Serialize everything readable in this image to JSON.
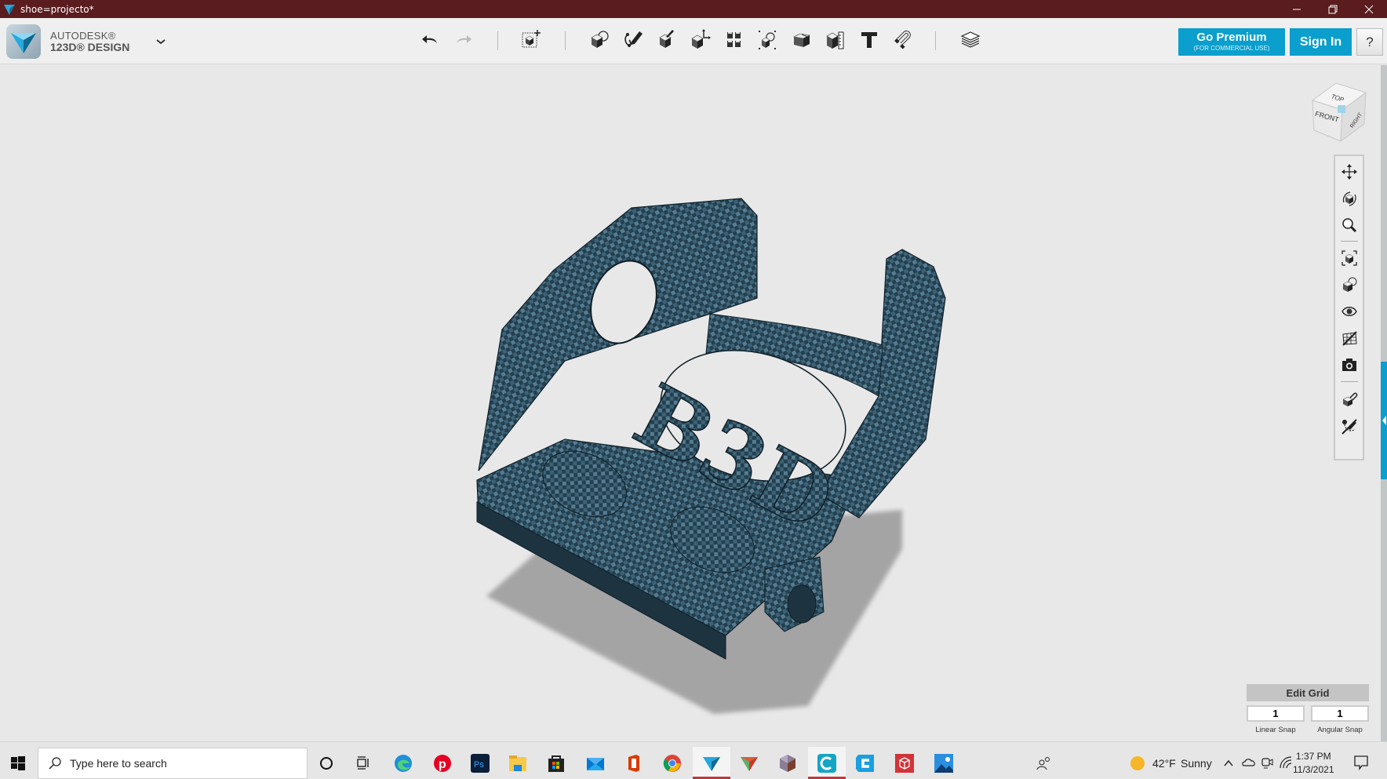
{
  "window": {
    "title": "shoe=projecto*",
    "controls": {
      "minimize": "minimize",
      "maximize": "restore",
      "close": "close"
    }
  },
  "app": {
    "brand_line1": "AUTODESK®",
    "brand_line2": "123D® DESIGN",
    "menu_caret": "chevron-down-icon"
  },
  "toolbar": {
    "tools": [
      {
        "name": "undo",
        "icon": "undo-icon",
        "enabled": true
      },
      {
        "name": "redo",
        "icon": "redo-icon",
        "enabled": false
      },
      {
        "name": "transform",
        "icon": "transform-icon",
        "enabled": true
      },
      {
        "name": "primitives",
        "icon": "primitives-icon",
        "enabled": true
      },
      {
        "name": "sketch",
        "icon": "sketch-icon",
        "enabled": true
      },
      {
        "name": "construct",
        "icon": "construct-icon",
        "enabled": true
      },
      {
        "name": "modify",
        "icon": "modify-icon",
        "enabled": true
      },
      {
        "name": "pattern",
        "icon": "pattern-icon",
        "enabled": true
      },
      {
        "name": "grouping",
        "icon": "grouping-icon",
        "enabled": true
      },
      {
        "name": "combine",
        "icon": "combine-icon",
        "enabled": true
      },
      {
        "name": "measure",
        "icon": "measure-icon",
        "enabled": true
      },
      {
        "name": "text",
        "icon": "text-icon",
        "enabled": true
      },
      {
        "name": "snap",
        "icon": "snap-magnet-icon",
        "enabled": true
      },
      {
        "name": "material",
        "icon": "material-layers-icon",
        "enabled": true
      }
    ],
    "premium_label": "Go Premium",
    "premium_sublabel": "(FOR COMMERCIAL USE)",
    "signin_label": "Sign In",
    "help_label": "?"
  },
  "navcube": {
    "top": "TOP",
    "front": "FRONT",
    "right": "RIGHT"
  },
  "navbar": {
    "items": [
      {
        "name": "pan",
        "icon": "pan-icon"
      },
      {
        "name": "orbit",
        "icon": "orbit-icon"
      },
      {
        "name": "zoom",
        "icon": "zoom-icon"
      },
      {
        "name": "fit",
        "icon": "fit-to-view-icon"
      },
      {
        "name": "views",
        "icon": "view-style-icon"
      },
      {
        "name": "visibility",
        "icon": "eye-icon"
      },
      {
        "name": "grid-toggle",
        "icon": "grid-visibility-icon"
      },
      {
        "name": "snapshot",
        "icon": "camera-icon"
      },
      {
        "name": "material-snap",
        "icon": "materials-icon"
      },
      {
        "name": "hide-sketch",
        "icon": "hide-sketch-icon"
      }
    ]
  },
  "grid": {
    "title": "Edit Grid",
    "linear_snap": "1",
    "angular_snap": "1",
    "linear_label": "Linear Snap",
    "angular_label": "Angular Snap"
  },
  "taskbar": {
    "search_placeholder": "Type here to search",
    "apps": [
      "cortana",
      "task-view",
      "edge",
      "pinterest",
      "photoshop",
      "file-explorer",
      "store",
      "mail",
      "office",
      "chrome",
      "123d-design",
      "meshmixer",
      "3d-builder",
      "cura",
      "creality",
      "3d-viewer",
      "photos"
    ],
    "active_app": "123d-design",
    "weather_temp": "42°F",
    "weather_desc": "Sunny",
    "time": "1:37 PM",
    "date": "11/3/2021"
  },
  "colors": {
    "titlebar": "#5a1c1e",
    "accent": "#0a9fcc",
    "model": "#2e4f63"
  }
}
